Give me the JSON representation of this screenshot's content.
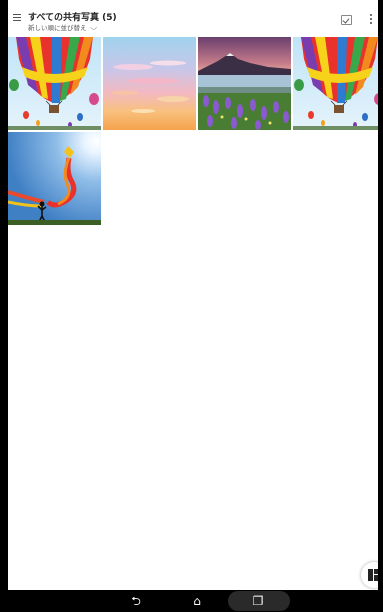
{
  "header": {
    "title": "すべての共有写真 (5)",
    "sort_label": "新しい順に並び替え",
    "sort_chevron": "⌵",
    "menu_icon": "hamburger-menu-icon",
    "select_icon": "select-checkbox-icon",
    "more_icon": "more-vertical-icon"
  },
  "photos": [
    {
      "subject": "hot-air-balloons"
    },
    {
      "subject": "pastel-sky-clouds"
    },
    {
      "subject": "mountain-lake-flowers"
    },
    {
      "subject": "hot-air-balloons"
    },
    {
      "subject": "kite-flyer"
    }
  ],
  "fab": {
    "icon": "layout-grid-icon"
  },
  "navbar": {
    "back": "⮌",
    "home": "⌂",
    "recents": "❐"
  }
}
